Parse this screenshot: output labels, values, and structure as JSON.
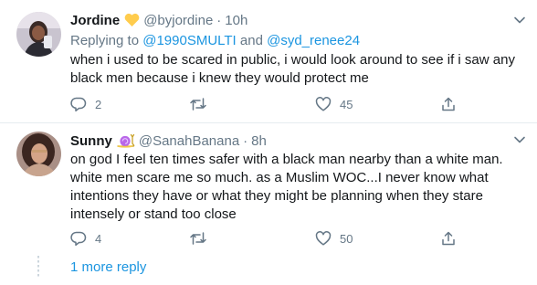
{
  "tweets": [
    {
      "name": "Jordine",
      "badge_icon": "yellow-heart-icon",
      "handle": "@byjordine",
      "separator": "·",
      "time": "10h",
      "replying": {
        "prefix": "Replying to ",
        "mention1": "@1990SMULTI",
        "joiner": " and ",
        "mention2": "@syd_renee24"
      },
      "lines": [
        "when i used to be scared in public, i would look around to see if i saw any",
        "black men because i knew they would protect me"
      ],
      "actions": {
        "replies": "2",
        "retweets": "",
        "likes": "45"
      }
    },
    {
      "name": "Sunny",
      "badge_icon": "snail-icon",
      "handle": "@SanahBanana",
      "separator": "·",
      "time": "8h",
      "lines": [
        "on god I feel ten times safer with a black man nearby than a white man.",
        "white men scare me so much. as a Muslim WOC...I never know what",
        "intentions they have or what they might be planning when they stare",
        "intensely or stand too close"
      ],
      "actions": {
        "replies": "4",
        "retweets": "",
        "likes": "50"
      }
    }
  ],
  "thread": {
    "more_replies": "1 more reply"
  },
  "colors": {
    "link": "#1b95e0",
    "muted": "#657786",
    "text": "#14171a",
    "divider": "#e6ecf0"
  }
}
